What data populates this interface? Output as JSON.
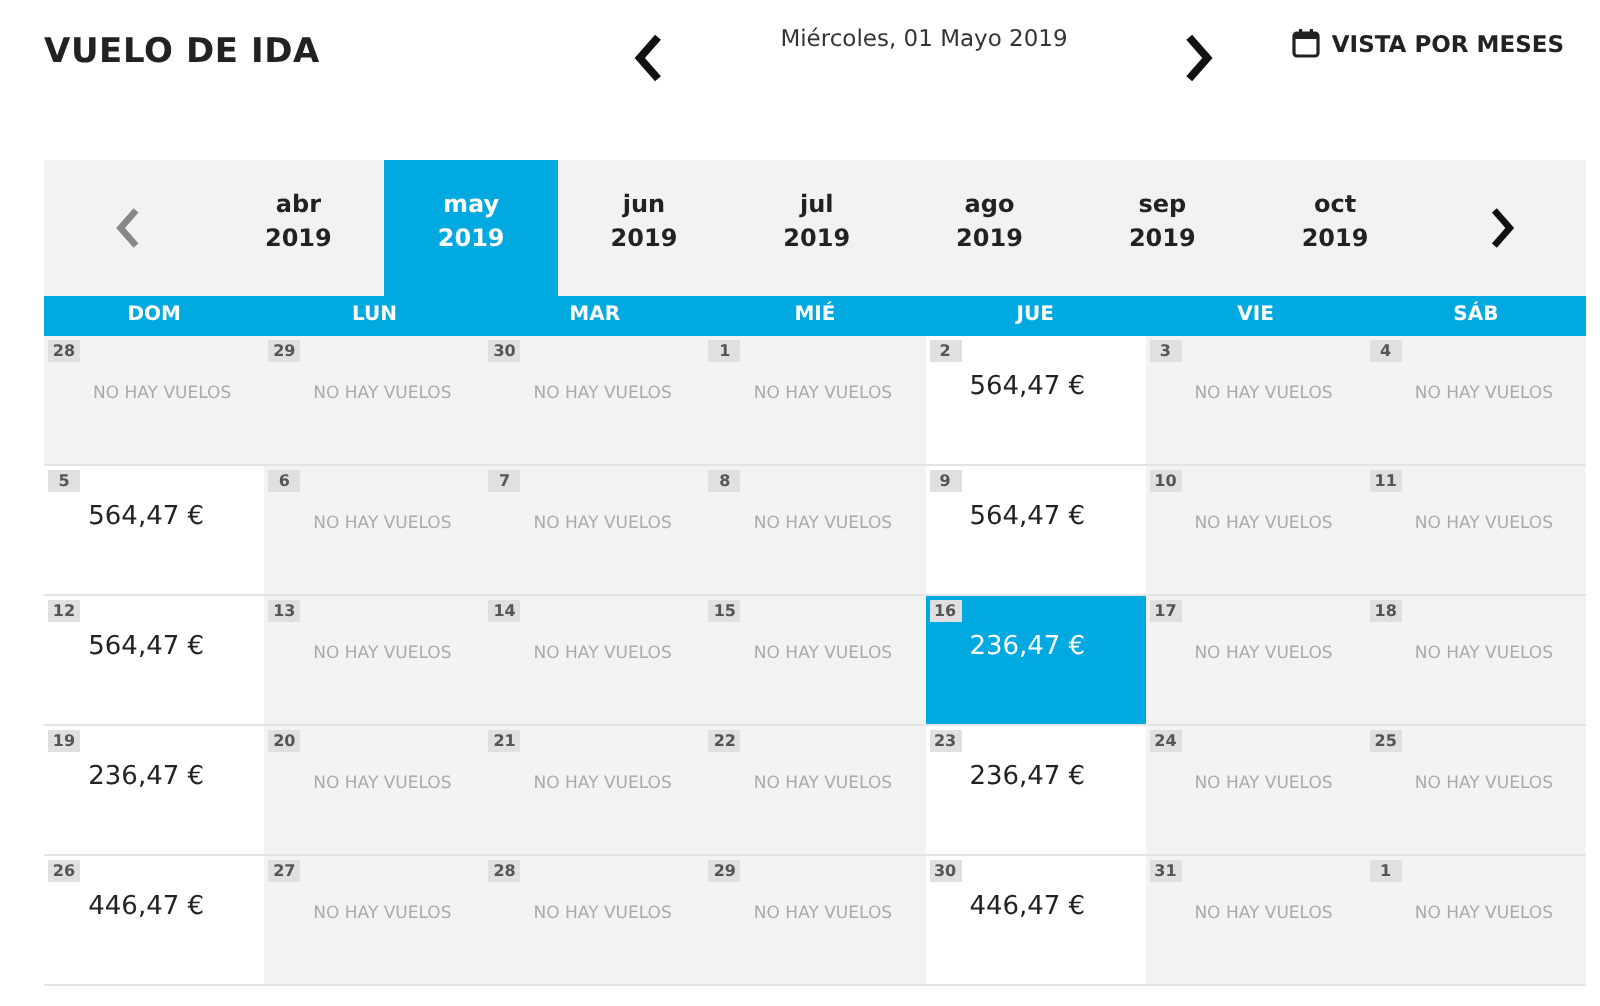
{
  "header": {
    "title": "VUELO DE IDA",
    "date": "Miércoles, 01 Mayo 2019",
    "view_button": "VISTA POR MESES"
  },
  "month_nav": {
    "prev_disabled": true,
    "next_disabled": false,
    "months": [
      {
        "month": "abr",
        "year": "2019",
        "selected": false
      },
      {
        "month": "may",
        "year": "2019",
        "selected": true
      },
      {
        "month": "jun",
        "year": "2019",
        "selected": false
      },
      {
        "month": "jul",
        "year": "2019",
        "selected": false
      },
      {
        "month": "ago",
        "year": "2019",
        "selected": false
      },
      {
        "month": "sep",
        "year": "2019",
        "selected": false
      },
      {
        "month": "oct",
        "year": "2019",
        "selected": false
      }
    ]
  },
  "weekdays": [
    "DOM",
    "LUN",
    "MAR",
    "MIÉ",
    "JUE",
    "VIE",
    "SÁB"
  ],
  "weeks": [
    [
      {
        "day": "28",
        "kind": "none",
        "text": "NO HAY VUELOS",
        "selected": false
      },
      {
        "day": "29",
        "kind": "none",
        "text": "NO HAY VUELOS",
        "selected": false
      },
      {
        "day": "30",
        "kind": "none",
        "text": "NO HAY VUELOS",
        "selected": false
      },
      {
        "day": "1",
        "kind": "none",
        "text": "NO HAY VUELOS",
        "selected": false
      },
      {
        "day": "2",
        "kind": "fare",
        "text": "564,47 €",
        "selected": false
      },
      {
        "day": "3",
        "kind": "none",
        "text": "NO HAY VUELOS",
        "selected": false
      },
      {
        "day": "4",
        "kind": "none",
        "text": "NO HAY VUELOS",
        "selected": false
      }
    ],
    [
      {
        "day": "5",
        "kind": "fare",
        "text": "564,47 €",
        "selected": false
      },
      {
        "day": "6",
        "kind": "none",
        "text": "NO HAY VUELOS",
        "selected": false
      },
      {
        "day": "7",
        "kind": "none",
        "text": "NO HAY VUELOS",
        "selected": false
      },
      {
        "day": "8",
        "kind": "none",
        "text": "NO HAY VUELOS",
        "selected": false
      },
      {
        "day": "9",
        "kind": "fare",
        "text": "564,47 €",
        "selected": false
      },
      {
        "day": "10",
        "kind": "none",
        "text": "NO HAY VUELOS",
        "selected": false
      },
      {
        "day": "11",
        "kind": "none",
        "text": "NO HAY VUELOS",
        "selected": false
      }
    ],
    [
      {
        "day": "12",
        "kind": "fare",
        "text": "564,47 €",
        "selected": false
      },
      {
        "day": "13",
        "kind": "none",
        "text": "NO HAY VUELOS",
        "selected": false
      },
      {
        "day": "14",
        "kind": "none",
        "text": "NO HAY VUELOS",
        "selected": false
      },
      {
        "day": "15",
        "kind": "none",
        "text": "NO HAY VUELOS",
        "selected": false
      },
      {
        "day": "16",
        "kind": "fare",
        "text": "236,47 €",
        "selected": true
      },
      {
        "day": "17",
        "kind": "none",
        "text": "NO HAY VUELOS",
        "selected": false
      },
      {
        "day": "18",
        "kind": "none",
        "text": "NO HAY VUELOS",
        "selected": false
      }
    ],
    [
      {
        "day": "19",
        "kind": "fare",
        "text": "236,47 €",
        "selected": false
      },
      {
        "day": "20",
        "kind": "none",
        "text": "NO HAY VUELOS",
        "selected": false
      },
      {
        "day": "21",
        "kind": "none",
        "text": "NO HAY VUELOS",
        "selected": false
      },
      {
        "day": "22",
        "kind": "none",
        "text": "NO HAY VUELOS",
        "selected": false
      },
      {
        "day": "23",
        "kind": "fare",
        "text": "236,47 €",
        "selected": false
      },
      {
        "day": "24",
        "kind": "none",
        "text": "NO HAY VUELOS",
        "selected": false
      },
      {
        "day": "25",
        "kind": "none",
        "text": "NO HAY VUELOS",
        "selected": false
      }
    ],
    [
      {
        "day": "26",
        "kind": "fare",
        "text": "446,47 €",
        "selected": false
      },
      {
        "day": "27",
        "kind": "none",
        "text": "NO HAY VUELOS",
        "selected": false
      },
      {
        "day": "28",
        "kind": "none",
        "text": "NO HAY VUELOS",
        "selected": false
      },
      {
        "day": "29",
        "kind": "none",
        "text": "NO HAY VUELOS",
        "selected": false
      },
      {
        "day": "30",
        "kind": "fare",
        "text": "446,47 €",
        "selected": false
      },
      {
        "day": "31",
        "kind": "none",
        "text": "NO HAY VUELOS",
        "selected": false
      },
      {
        "day": "1",
        "kind": "none",
        "text": "NO HAY VUELOS",
        "selected": false
      }
    ]
  ]
}
